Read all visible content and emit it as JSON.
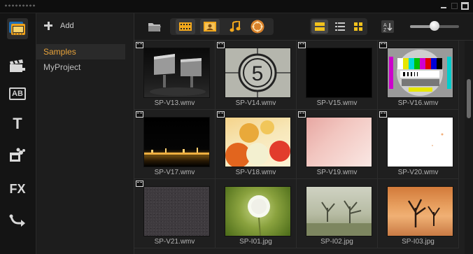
{
  "window": {
    "controls": [
      "minimize-icon",
      "restore-icon",
      "maximize-icon"
    ]
  },
  "sidebar": {
    "tools": [
      {
        "name": "media-library",
        "icon": "media-film-icon",
        "active": true
      },
      {
        "name": "instant-project",
        "icon": "clapper-icon"
      },
      {
        "name": "transition",
        "icon": "ab-transition-icon",
        "text": "AB"
      },
      {
        "name": "title",
        "icon": "title-t-icon",
        "text": "T"
      },
      {
        "name": "graphic",
        "icon": "graphic-icon"
      },
      {
        "name": "filter",
        "icon": "fx-icon",
        "text": "FX"
      },
      {
        "name": "path",
        "icon": "path-icon"
      }
    ]
  },
  "library": {
    "add_label": "Add",
    "folders": [
      {
        "label": "Samples",
        "active": true
      },
      {
        "label": "MyProject",
        "active": false
      }
    ]
  },
  "toolbar": {
    "buttons": [
      "browse-folder-icon",
      "show-videos-icon",
      "show-photos-icon",
      "show-audio-icon",
      "show-effects-icon",
      "thumbnail-view-icon",
      "list-view-icon",
      "large-icon-view-icon",
      "sort-icon"
    ],
    "zoom_level": 0.5
  },
  "media": {
    "items": [
      {
        "name": "SP-V13.wmv",
        "type": "video",
        "art": "billboards"
      },
      {
        "name": "SP-V14.wmv",
        "type": "video",
        "art": "countdown"
      },
      {
        "name": "SP-V15.wmv",
        "type": "video",
        "art": "black"
      },
      {
        "name": "SP-V16.wmv",
        "type": "video",
        "art": "testcard"
      },
      {
        "name": "SP-V17.wmv",
        "type": "video",
        "art": "city-night"
      },
      {
        "name": "SP-V18.wmv",
        "type": "video",
        "art": "balloons"
      },
      {
        "name": "SP-V19.wmv",
        "type": "video",
        "art": "pink"
      },
      {
        "name": "SP-V20.wmv",
        "type": "video",
        "art": "white"
      },
      {
        "name": "SP-V21.wmv",
        "type": "video",
        "art": "noise"
      },
      {
        "name": "SP-I01.jpg",
        "type": "image",
        "art": "dandelion"
      },
      {
        "name": "SP-I02.jpg",
        "type": "image",
        "art": "trees-fog"
      },
      {
        "name": "SP-I03.jpg",
        "type": "image",
        "art": "desert"
      }
    ]
  },
  "colors": {
    "accent": "#e8a33a",
    "background": "#1f1f1f"
  }
}
